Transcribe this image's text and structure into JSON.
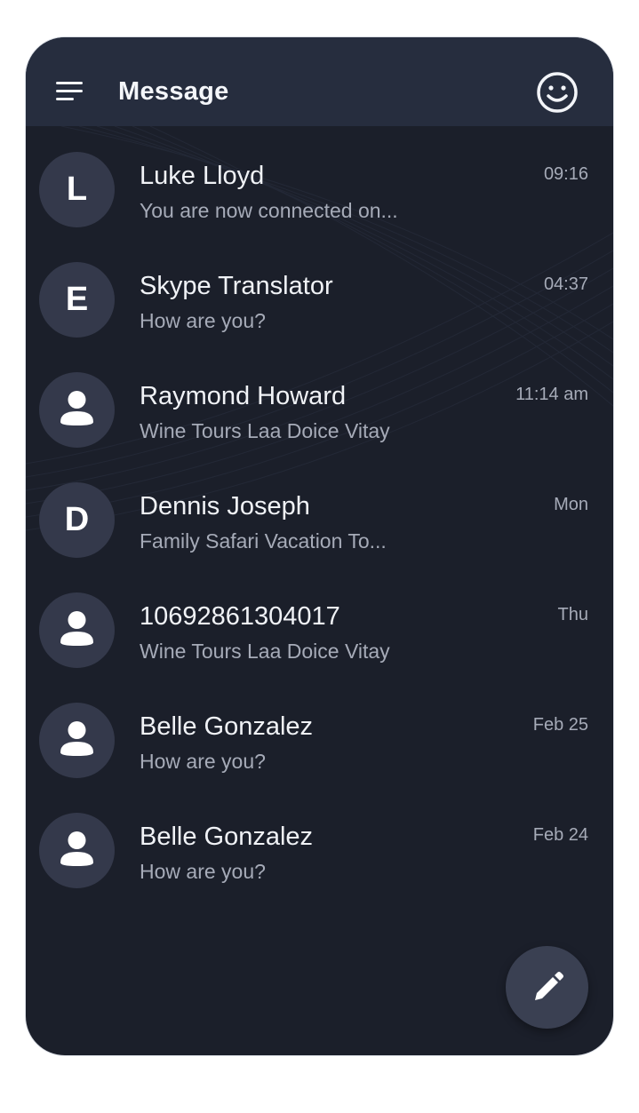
{
  "app": {
    "title": "Message"
  },
  "icons": {
    "menu": "menu-icon",
    "smile": "smile-icon",
    "person": "person-icon",
    "compose": "pencil-icon"
  },
  "colors": {
    "background": "#1b1f2a",
    "appbar": "#262d3e",
    "avatar": "#34394b",
    "primary_text": "#f0f2f6",
    "secondary_text": "#a6abb8"
  },
  "conversations": [
    {
      "initial": "L",
      "name": "Luke Lloyd",
      "preview": "You are now connected on...",
      "time": "09:16"
    },
    {
      "initial": "E",
      "name": "Skype Translator",
      "preview": "How are you?",
      "time": "04:37"
    },
    {
      "initial": "",
      "name": "Raymond Howard",
      "preview": "Wine Tours Laa Doice Vitay",
      "time": "11:14 am"
    },
    {
      "initial": "D",
      "name": "Dennis Joseph",
      "preview": "Family Safari Vacation To...",
      "time": "Mon"
    },
    {
      "initial": "",
      "name": "10692861304017",
      "preview": "Wine Tours Laa Doice Vitay",
      "time": "Thu"
    },
    {
      "initial": "",
      "name": "Belle Gonzalez",
      "preview": "How are you?",
      "time": "Feb 25"
    },
    {
      "initial": "",
      "name": "Belle Gonzalez",
      "preview": "How are you?",
      "time": "Feb 24"
    }
  ]
}
